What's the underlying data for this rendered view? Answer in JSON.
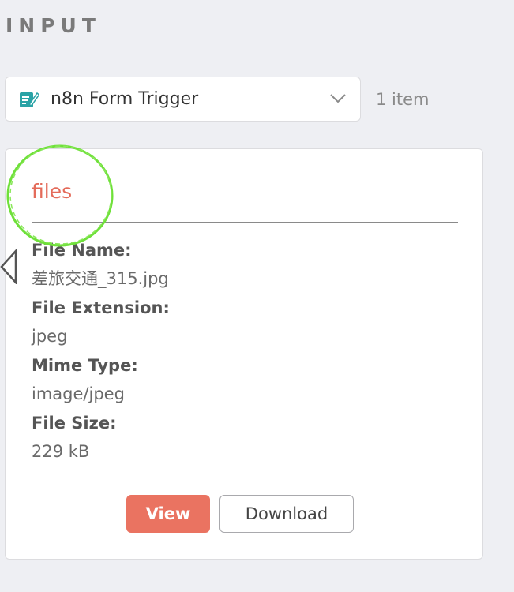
{
  "section": {
    "title": "INPUT"
  },
  "node_selector": {
    "icon": "form-trigger-icon",
    "label": "n8n Form Trigger",
    "item_count": "1 item"
  },
  "card": {
    "title": "files",
    "fields": [
      {
        "label": "File Name:",
        "value": "差旅交通_315.jpg"
      },
      {
        "label": "File Extension:",
        "value": "jpeg"
      },
      {
        "label": "Mime Type:",
        "value": "image/jpeg"
      },
      {
        "label": "File Size:",
        "value": "229 kB"
      }
    ],
    "view_label": "View",
    "download_label": "Download"
  },
  "colors": {
    "accent": "#ea7361",
    "title_orange": "#e46b5a",
    "icon_teal": "#2aa3a6",
    "annotation_green": "#6fe03a"
  }
}
